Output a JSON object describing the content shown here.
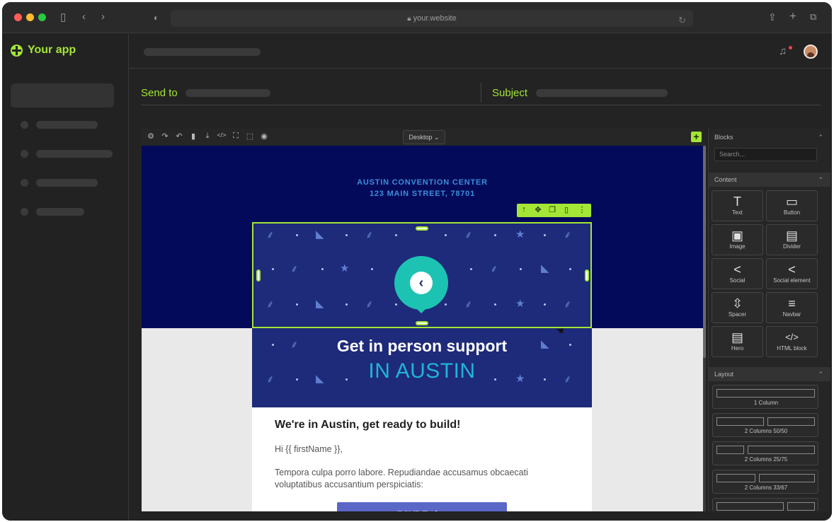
{
  "browser": {
    "url": "your.website"
  },
  "app": {
    "name": "Your app"
  },
  "compose": {
    "send_to_label": "Send to",
    "subject_label": "Subject"
  },
  "editor": {
    "device_select": "Desktop",
    "add_label": "+"
  },
  "email": {
    "address_line1": "AUSTIN CONVENTION CENTER",
    "address_line2": "123 MAIN STREET, 78701",
    "hero_title": "Get in person support",
    "hero_subtitle": "IN AUSTIN",
    "heading": "We're in Austin, get ready to build!",
    "greeting": "Hi {{ firstName }},",
    "body": "Tempora culpa porro labore. Repudiandae accusamus obcaecati voluptatibus accusantium perspiciatis:",
    "cta_label": "RSVP Today"
  },
  "panel": {
    "blocks_title": "Blocks",
    "search_placeholder": "Search...",
    "content_title": "Content",
    "content_blocks": [
      {
        "label": "Text",
        "icon": "text-icon"
      },
      {
        "label": "Button",
        "icon": "button-icon"
      },
      {
        "label": "Image",
        "icon": "image-icon"
      },
      {
        "label": "Divider",
        "icon": "divider-icon"
      },
      {
        "label": "Social",
        "icon": "share-icon"
      },
      {
        "label": "Social element",
        "icon": "share-icon"
      },
      {
        "label": "Spacer",
        "icon": "spacer-icon"
      },
      {
        "label": "Navbar",
        "icon": "menu-icon"
      },
      {
        "label": "Hero",
        "icon": "hero-icon"
      },
      {
        "label": "HTML block",
        "icon": "code-icon"
      }
    ],
    "layout_title": "Layout",
    "layouts": [
      {
        "label": "1 Column"
      },
      {
        "label": "2 Columns 50/50"
      },
      {
        "label": "2 Columns 25/75"
      },
      {
        "label": "2 Columns 33/67"
      }
    ]
  },
  "colors": {
    "accent": "#a3e635",
    "email_navy": "#040a5a",
    "hero_blue": "#1e2a7a",
    "teal": "#1dc3b2",
    "cta": "#5b67c7"
  }
}
